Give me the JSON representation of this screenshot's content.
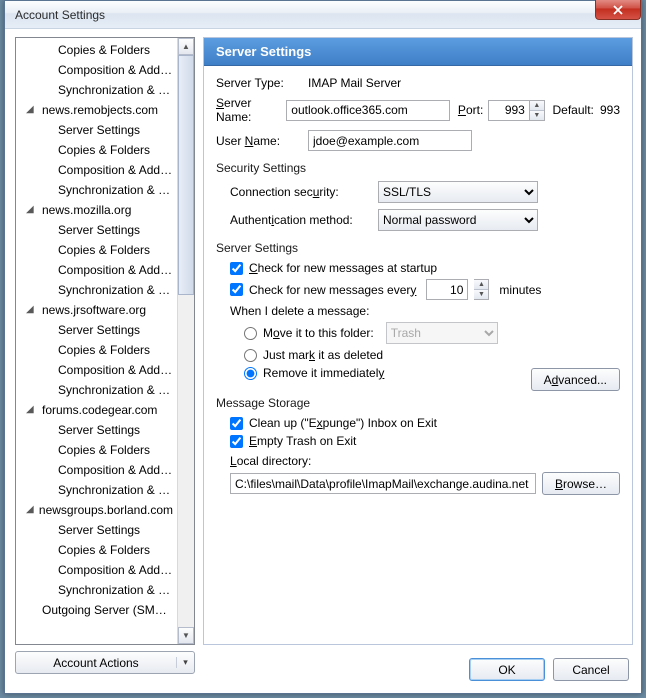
{
  "window": {
    "title": "Account Settings"
  },
  "tree": [
    {
      "type": "child",
      "label": "Copies & Folders"
    },
    {
      "type": "child",
      "label": "Composition & Addres..."
    },
    {
      "type": "child",
      "label": "Synchronization & Stor..."
    },
    {
      "type": "parent",
      "label": "news.remobjects.com"
    },
    {
      "type": "child",
      "label": "Server Settings"
    },
    {
      "type": "child",
      "label": "Copies & Folders"
    },
    {
      "type": "child",
      "label": "Composition & Addres..."
    },
    {
      "type": "child",
      "label": "Synchronization & Stor..."
    },
    {
      "type": "parent",
      "label": "news.mozilla.org"
    },
    {
      "type": "child",
      "label": "Server Settings"
    },
    {
      "type": "child",
      "label": "Copies & Folders"
    },
    {
      "type": "child",
      "label": "Composition & Addres..."
    },
    {
      "type": "child",
      "label": "Synchronization & Stor..."
    },
    {
      "type": "parent",
      "label": "news.jrsoftware.org"
    },
    {
      "type": "child",
      "label": "Server Settings"
    },
    {
      "type": "child",
      "label": "Copies & Folders"
    },
    {
      "type": "child",
      "label": "Composition & Addres..."
    },
    {
      "type": "child",
      "label": "Synchronization & Stor..."
    },
    {
      "type": "parent",
      "label": "forums.codegear.com"
    },
    {
      "type": "child",
      "label": "Server Settings"
    },
    {
      "type": "child",
      "label": "Copies & Folders"
    },
    {
      "type": "child",
      "label": "Composition & Addres..."
    },
    {
      "type": "child",
      "label": "Synchronization & Stor..."
    },
    {
      "type": "parent",
      "label": "newsgroups.borland.com"
    },
    {
      "type": "child",
      "label": "Server Settings"
    },
    {
      "type": "child",
      "label": "Copies & Folders"
    },
    {
      "type": "child",
      "label": "Composition & Addres..."
    },
    {
      "type": "child",
      "label": "Synchronization & Stor..."
    },
    {
      "type": "child-top",
      "label": "Outgoing Server (SMTP)"
    }
  ],
  "account_actions": {
    "label": "Account Actions"
  },
  "panel": {
    "header": "Server Settings",
    "server_type_label": "Server Type:",
    "server_type_value": "IMAP Mail Server",
    "server_name_label": "Server Name:",
    "server_name_value": "outlook.office365.com",
    "port_label": "Port:",
    "port_value": "993",
    "default_label": "Default:",
    "default_value": "993",
    "user_name_label": "User Name:",
    "user_name_value": "jdoe@example.com",
    "security_heading": "Security Settings",
    "conn_sec_label": "Connection security:",
    "conn_sec_value": "SSL/TLS",
    "auth_label": "Authentication method:",
    "auth_value": "Normal password",
    "server_settings_heading": "Server Settings",
    "check_startup": "Check for new messages at startup",
    "check_every_a": "Check for new messages every",
    "check_every_min": "10",
    "check_every_b": "minutes",
    "when_delete": "When I delete a message:",
    "move_to": "Move it to this folder:",
    "trash_value": "Trash",
    "just_mark": "Just mark it as deleted",
    "remove_imm": "Remove it immediately",
    "advanced": "Advanced...",
    "storage_heading": "Message Storage",
    "expunge": "Clean up (\"Expunge\") Inbox on Exit",
    "empty_trash": "Empty Trash on Exit",
    "local_dir_label": "Local directory:",
    "local_dir_value": "C:\\files\\mail\\Data\\profile\\ImapMail\\exchange.audina.net",
    "browse": "Browse..."
  },
  "footer": {
    "ok": "OK",
    "cancel": "Cancel"
  }
}
